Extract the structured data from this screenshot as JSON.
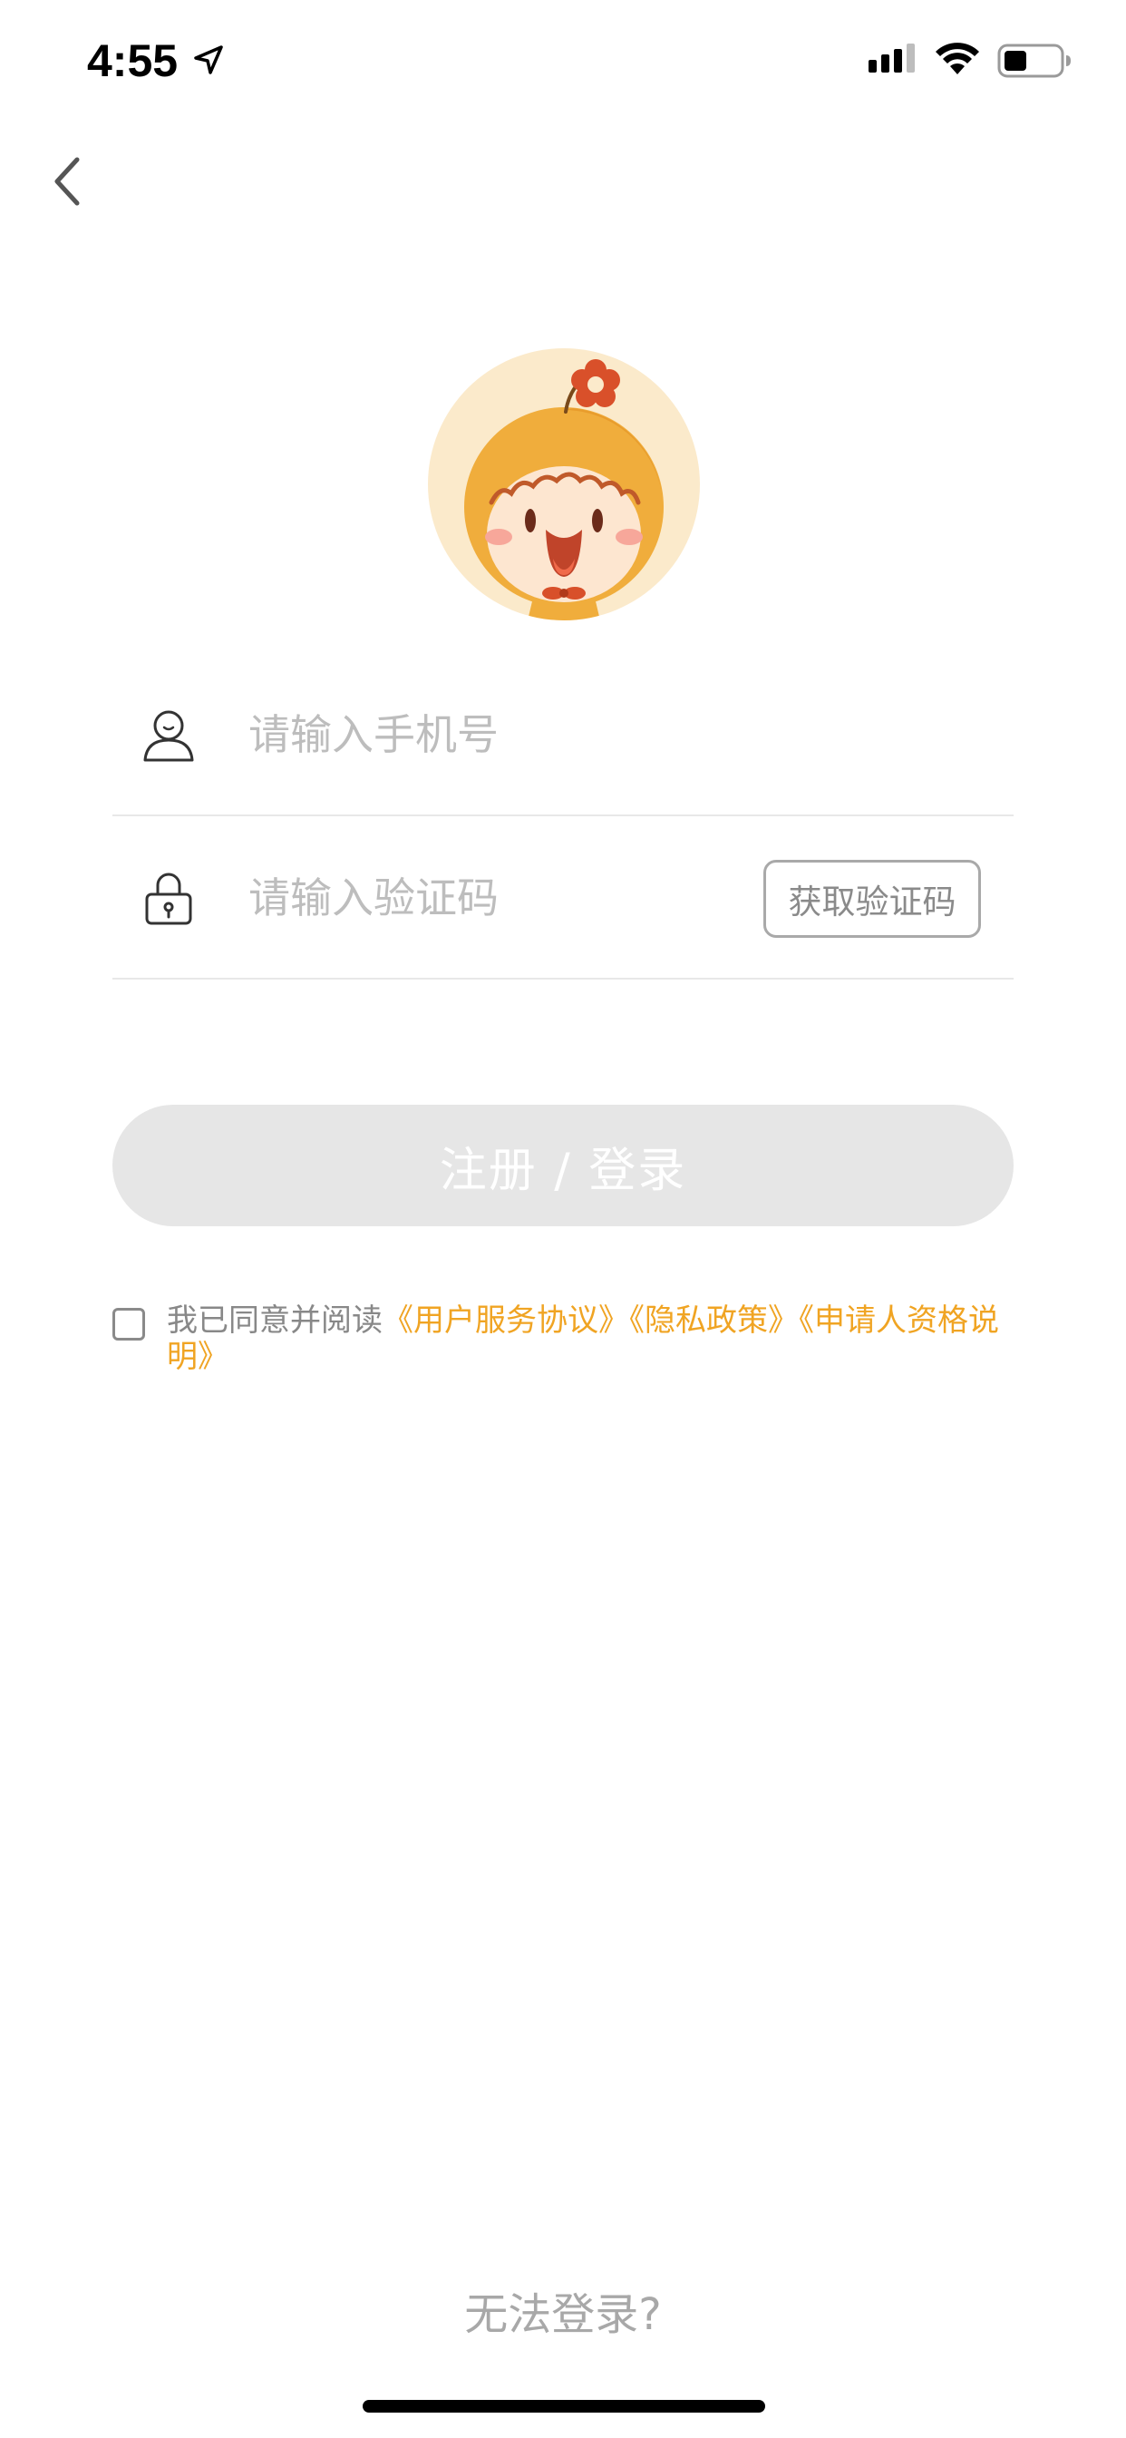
{
  "status_bar": {
    "time": "4:55"
  },
  "icons": {
    "location": "location-arrow-icon",
    "signal": "cellular-signal-icon",
    "wifi": "wifi-icon",
    "battery": "battery-icon",
    "back": "chevron-left-icon",
    "user": "user-icon",
    "lock": "lock-icon"
  },
  "form": {
    "phone_placeholder": "请输入手机号",
    "code_placeholder": "请输入验证码",
    "get_code_label": "获取验证码"
  },
  "submit": {
    "label": "注册 / 登录"
  },
  "agreement": {
    "prefix": "我已同意并阅读",
    "links": [
      "《用户服务协议》",
      "《隐私政策》",
      "《申请人资格说明》"
    ]
  },
  "footer": {
    "cannot_login": "无法登录?"
  },
  "colors": {
    "accent": "#f0a423",
    "submit_bg_disabled": "#e6e6e6",
    "placeholder": "#bdbdbd",
    "divider": "#e8e8e8"
  }
}
